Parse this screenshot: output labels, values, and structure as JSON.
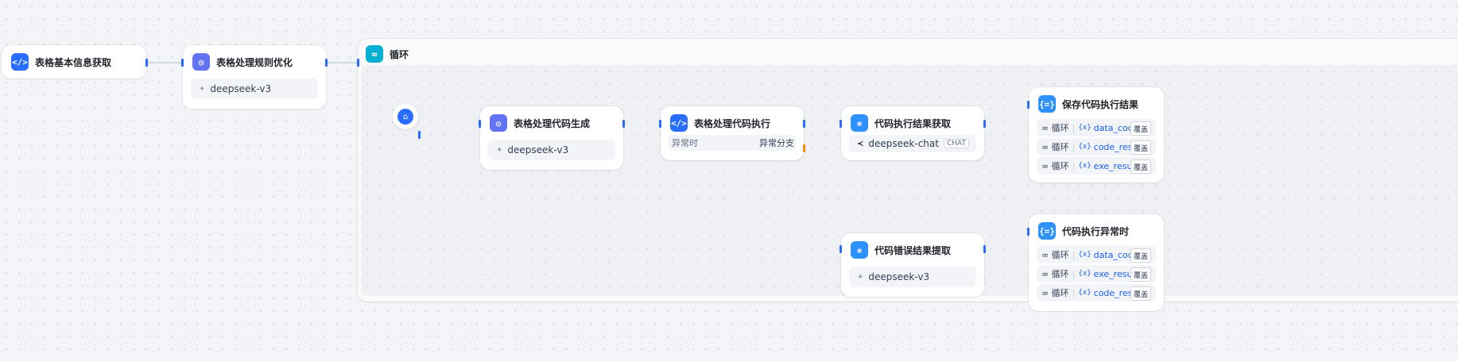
{
  "nodes": {
    "table_info": {
      "title": "表格基本信息获取",
      "icon": "code-icon"
    },
    "rule_opt": {
      "title": "表格处理规则优化",
      "icon": "llm-icon",
      "model": "deepseek-v3"
    },
    "loop": {
      "title": "循环",
      "icon": "loop-icon"
    },
    "code_gen": {
      "title": "表格处理代码生成",
      "icon": "llm-icon",
      "model": "deepseek-v3"
    },
    "code_exec": {
      "title": "表格处理代码执行",
      "icon": "code-icon",
      "exception_label": "异常时",
      "exception_branch": "异常分支"
    },
    "exec_result": {
      "title": "代码执行结果获取",
      "icon": "llm-icon",
      "model": "deepseek-chat",
      "model_badge": "CHAT"
    },
    "save_result": {
      "title": "保存代码执行结果",
      "icon": "assign-icon",
      "vars": [
        {
          "scope": "循环",
          "name": "data_code",
          "tag": "覆盖"
        },
        {
          "scope": "循环",
          "name": "code_result",
          "tag": "覆盖"
        },
        {
          "scope": "循环",
          "name": "exe_result",
          "tag": "覆盖"
        }
      ]
    },
    "error_extract": {
      "title": "代码错误结果提取",
      "icon": "llm-icon",
      "model": "deepseek-v3"
    },
    "exec_error": {
      "title": "代码执行异常时",
      "icon": "assign-icon",
      "vars": [
        {
          "scope": "循环",
          "name": "data_code",
          "tag": "覆盖"
        },
        {
          "scope": "循环",
          "name": "exe_result",
          "tag": "覆盖"
        },
        {
          "scope": "循环",
          "name": "code_result",
          "tag": "覆盖"
        }
      ]
    }
  },
  "colors": {
    "accent": "#296dff",
    "edge": "#c8ccd4",
    "exception": "#f79009"
  }
}
